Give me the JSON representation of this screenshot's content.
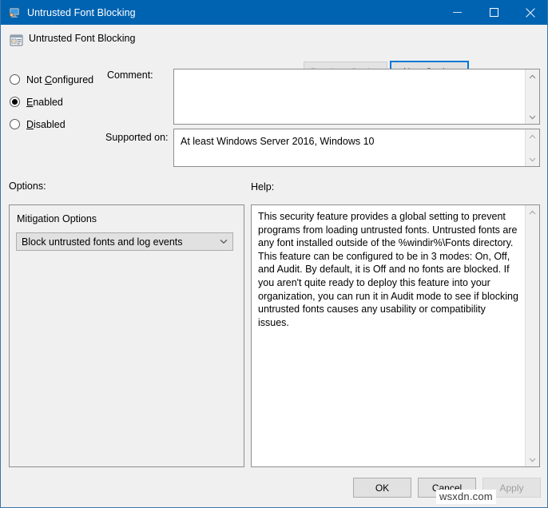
{
  "window": {
    "title": "Untrusted Font Blocking",
    "app_icon": "monitor-policy-icon",
    "minimize_icon": "minimize-icon",
    "maximize_icon": "maximize-icon",
    "close_icon": "close-icon",
    "titlebar_color": "#0063b1",
    "border_color": "#3a76a8",
    "background_color": "#f0f0f0"
  },
  "header": {
    "policy_icon": "policy-setting-icon",
    "policy_title": "Untrusted Font Blocking",
    "previous_setting": {
      "label": "Previous Setting",
      "accelerator": "P",
      "enabled": false
    },
    "next_setting": {
      "label": "Next Setting",
      "accelerator": "N",
      "enabled": true,
      "focused": true,
      "focus_color": "#0078d7"
    }
  },
  "state_options": [
    {
      "label": "Not Configured",
      "accel_before": "Not ",
      "accel": "C",
      "accel_after": "onfigured",
      "selected": false
    },
    {
      "label": "Enabled",
      "accel_before": "",
      "accel": "E",
      "accel_after": "nabled",
      "selected": true
    },
    {
      "label": "Disabled",
      "accel_before": "",
      "accel": "D",
      "accel_after": "isabled",
      "selected": false
    }
  ],
  "comment": {
    "label": "Comment:",
    "value": "",
    "scrollbar": "vertical-scrollbar"
  },
  "supported_on": {
    "label": "Supported on:",
    "value": "At least Windows Server 2016, Windows 10",
    "scrollbar": "vertical-scrollbar"
  },
  "options": {
    "heading": "Options:",
    "mitigation_label": "Mitigation Options",
    "dropdown": {
      "selected": "Block untrusted fonts and log events",
      "arrow_icon": "chevron-down-icon"
    }
  },
  "help": {
    "heading": "Help:",
    "text": "This security feature provides a global setting to prevent programs from loading untrusted fonts. Untrusted fonts are any font installed outside of the %windir%\\Fonts directory. This feature can be configured to be in 3 modes: On, Off, and Audit. By default, it is Off and no fonts are blocked. If you aren't quite ready to deploy this feature into your organization, you can run it in Audit mode to see if blocking untrusted fonts causes any usability or compatibility issues.",
    "scrollbar": "vertical-scrollbar"
  },
  "footer": {
    "ok": "OK",
    "cancel": "Cancel",
    "apply": "Apply",
    "apply_enabled": false
  },
  "watermark": "wsxdn.com"
}
